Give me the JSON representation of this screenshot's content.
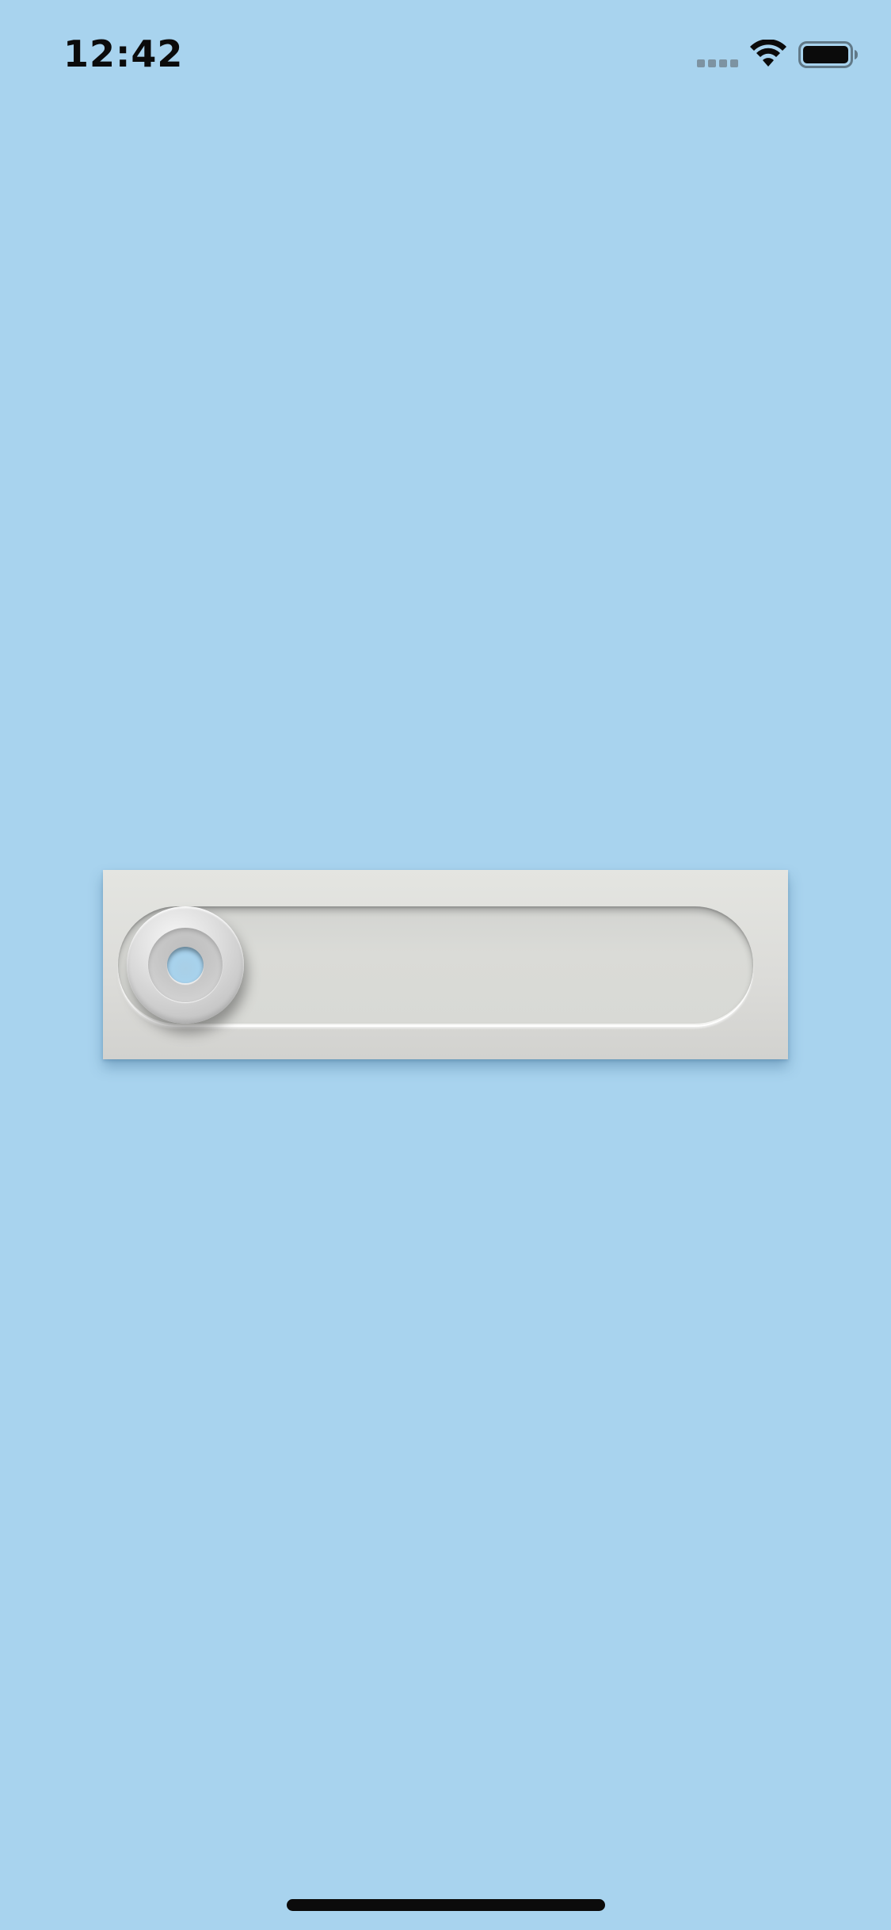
{
  "status_bar": {
    "time": "12:42",
    "signal": "signal-icon",
    "wifi": "wifi-icon",
    "battery": "battery-icon",
    "text_color": "#0b0b0b",
    "signal_color": "#7d93a2"
  },
  "colors": {
    "background": "#a8d3ee",
    "panel": "#dcdcd9",
    "knob": "#d6d6d6",
    "home_indicator": "#0b0b0b"
  },
  "slider": {
    "value_fraction": 0
  }
}
